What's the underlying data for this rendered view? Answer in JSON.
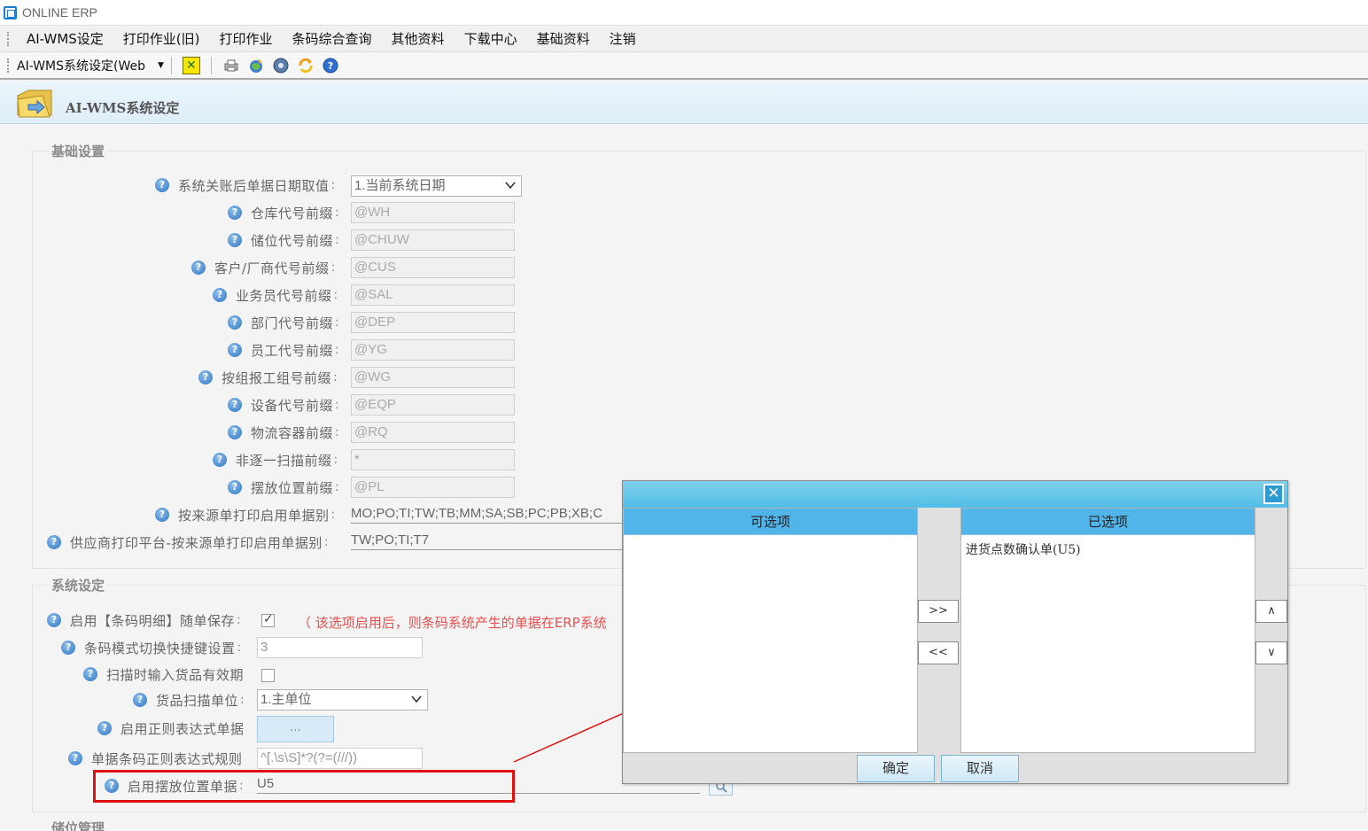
{
  "window": {
    "title": "ONLINE ERP"
  },
  "menu": {
    "items": [
      "AI-WMS设定",
      "打印作业(旧)",
      "打印作业",
      "条码综合查询",
      "其他资料",
      "下载中心",
      "基础资料",
      "注销"
    ]
  },
  "toolbar": {
    "selected": "AI-WMS系统设定(Web"
  },
  "page": {
    "title": "AI-WMS系统设定"
  },
  "basic": {
    "legend": "基础设置",
    "date_label": "系统关账后单据日期取值",
    "date_value": "1.当前系统日期",
    "fields": [
      {
        "label": "仓库代号前缀",
        "value": "@WH"
      },
      {
        "label": "储位代号前缀",
        "value": "@CHUW"
      },
      {
        "label": "客户/厂商代号前缀",
        "value": "@CUS"
      },
      {
        "label": "业务员代号前缀",
        "value": "@SAL"
      },
      {
        "label": "部门代号前缀",
        "value": "@DEP"
      },
      {
        "label": "员工代号前缀",
        "value": "@YG"
      },
      {
        "label": "按组报工组号前缀",
        "value": "@WG"
      },
      {
        "label": "设备代号前缀",
        "value": "@EQP"
      },
      {
        "label": "物流容器前缀",
        "value": "@RQ"
      },
      {
        "label": "非逐一扫描前缀",
        "value": "*"
      },
      {
        "label": "摆放位置前缀",
        "value": "@PL"
      }
    ],
    "source_print_label": "按来源单打印启用单据别",
    "source_print_value": "MO;PO;TI;TW;TB;MM;SA;SB;PC;PB;XB;C",
    "supplier_print_label": "供应商打印平台-按来源单打印启用单据别",
    "supplier_print_value": "TW;PO;TI;T7"
  },
  "system": {
    "legend": "系统设定",
    "save_label": "启用【条码明细】随单保存",
    "save_hint": "（ 该选项启用后，则条码系统产生的单据在ERP系统",
    "shortcut_label": "条码模式切换快捷键设置",
    "shortcut_value": "3",
    "expiry_label": "扫描时输入货品有效期",
    "unit_label": "货品扫描单位",
    "unit_value": "1.主单位",
    "regex_docs_label": "启用正则表达式单据",
    "regex_docs_btn": "...",
    "regex_rule_label": "单据条码正则表达式规则",
    "regex_rule_value": "^[.\\s\\S]*?(?=(///))",
    "placement_label": "启用摆放位置单据",
    "placement_value": "U5"
  },
  "storage": {
    "legend": "储位管理"
  },
  "dialog": {
    "close": "✕",
    "available_header": "可选项",
    "selected_header": "已选项",
    "selected_items": [
      "进货点数确认单(U5)"
    ],
    "add_btn": ">>",
    "remove_btn": "<<",
    "up_btn": "∧",
    "down_btn": "∨",
    "ok_btn": "确定",
    "cancel_btn": "取消"
  }
}
